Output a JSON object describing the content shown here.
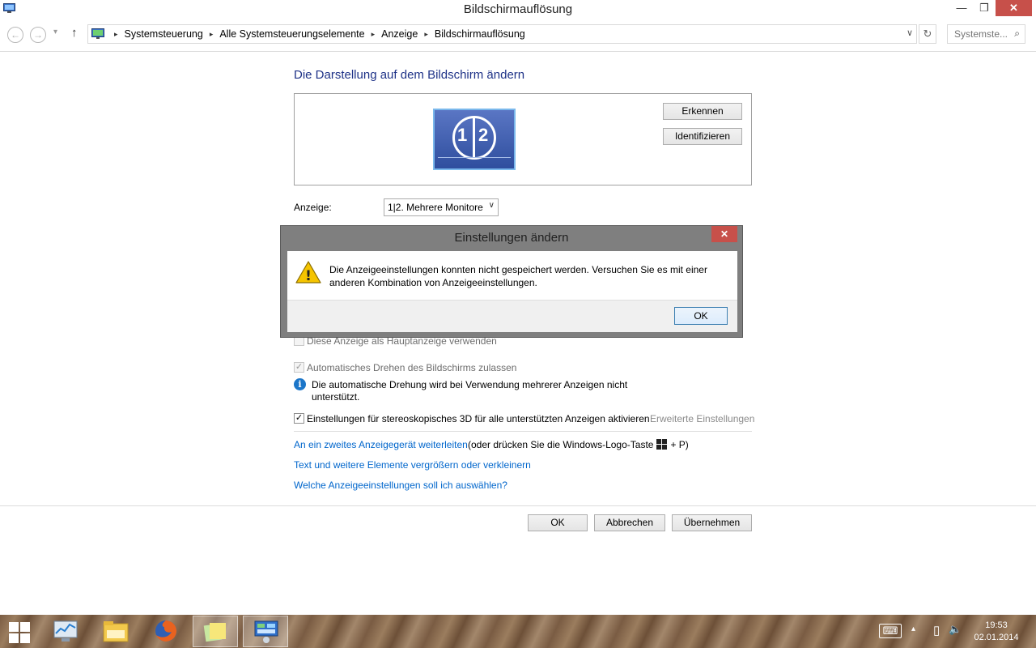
{
  "window": {
    "title": "Bildschirmauflösung",
    "minimize_glyph": "—",
    "restore_glyph": "❐",
    "close_glyph": "✕"
  },
  "navigation": {
    "back_glyph": "←",
    "forward_glyph": "→",
    "history_glyph": "▾",
    "up_glyph": "↑",
    "breadcrumbs": [
      "Systemsteuerung",
      "Alle Systemsteuerungselemente",
      "Anzeige",
      "Bildschirmauflösung"
    ],
    "breadcrumb_separator": "▸",
    "dropdown_glyph": "∨",
    "refresh_glyph": "↻",
    "search_placeholder": "Systemste...",
    "search_icon_glyph": "⌕"
  },
  "main": {
    "heading": "Die Darstellung auf dem Bildschirm ändern",
    "monitor": {
      "left_number": "1",
      "right_number": "2"
    },
    "detect_button": "Erkennen",
    "identify_button": "Identifizieren",
    "display_label": "Anzeige:",
    "display_value": "1|2. Mehrere Monitore",
    "select_arrow": "∨",
    "main_display_checkbox": {
      "label": "Diese Anzeige als Hauptanzeige verwenden",
      "checked": false,
      "enabled": false
    },
    "auto_rotate_checkbox": {
      "label": "Automatisches Drehen des Bildschirms zulassen",
      "checked": true,
      "enabled": false,
      "mark": "✓"
    },
    "info_icon_glyph": "i",
    "info_text_line1": "Die automatische Drehung wird bei Verwendung mehrerer Anzeigen nicht",
    "info_text_line2": "unterstützt.",
    "stereo_checkbox": {
      "label": "Einstellungen für stereoskopisches 3D für alle unterstützten Anzeigen aktivieren",
      "checked": true,
      "enabled": true,
      "mark": "✓"
    },
    "advanced_settings": "Erweiterte Einstellungen",
    "project_link": "An ein zweites Anzeigegerät weiterleiten",
    "project_hint_prefix": "(oder drücken Sie die Windows-Logo-Taste",
    "project_hint_suffix": "+ P)",
    "text_size_link": "Text und weitere Elemente vergrößern oder verkleinern",
    "which_settings_link": "Welche Anzeigeeinstellungen soll ich auswählen?"
  },
  "footer": {
    "ok": "OK",
    "cancel": "Abbrechen",
    "apply": "Übernehmen"
  },
  "dialog": {
    "title": "Einstellungen ändern",
    "close_glyph": "✕",
    "warning_glyph": "!",
    "message_line1": "Die Anzeigeeinstellungen konnten nicht gespeichert werden. Versuchen Sie es mit einer",
    "message_line2": "anderen Kombination von Anzeigeeinstellungen.",
    "ok": "OK"
  },
  "taskbar": {
    "apps": [
      {
        "name": "performance-monitor-icon",
        "active": false
      },
      {
        "name": "file-explorer-icon",
        "active": false
      },
      {
        "name": "firefox-icon",
        "active": false
      },
      {
        "name": "sticky-notes-icon",
        "active": true
      },
      {
        "name": "control-panel-icon",
        "active": true
      }
    ],
    "tray": {
      "keyboard_glyph": "⌨",
      "chevron_glyph": "▴",
      "battery_glyph": "▯",
      "volume_glyph": "🔈"
    },
    "time": "19:53",
    "date": "02.01.2014"
  }
}
